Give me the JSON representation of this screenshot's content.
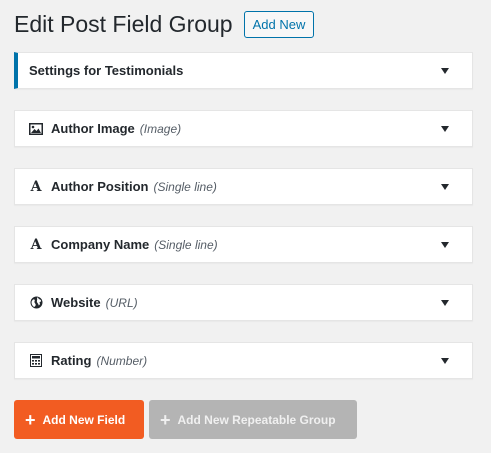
{
  "header": {
    "title": "Edit Post Field Group",
    "add_new_label": "Add New"
  },
  "panels": [
    {
      "title": "Settings for Testimonials",
      "type": "",
      "icon": ""
    },
    {
      "title": "Author Image",
      "type": "(Image)",
      "icon": "image-icon"
    },
    {
      "title": "Author Position",
      "type": "(Single line)",
      "icon": "text-icon"
    },
    {
      "title": "Company Name",
      "type": "(Single line)",
      "icon": "text-icon"
    },
    {
      "title": "Website",
      "type": "(URL)",
      "icon": "globe-icon"
    },
    {
      "title": "Rating",
      "type": "(Number)",
      "icon": "calculator-icon"
    }
  ],
  "buttons": {
    "add_field_label": "Add New Field",
    "add_group_label": "Add New Repeatable Group"
  },
  "colors": {
    "accent": "#0073aa",
    "primary_button": "#f25c22",
    "disabled_button": "#b4b4b4"
  }
}
